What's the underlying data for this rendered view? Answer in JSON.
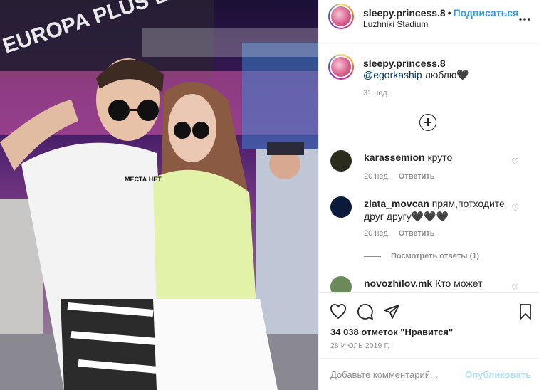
{
  "photo": {
    "stage_sign": "EUROPA PLUS LIVE",
    "shirt_text": "МЕСТА НЕТ"
  },
  "header": {
    "username": "sleepy.princess.8",
    "dot": "•",
    "follow_label": "Подписаться",
    "location": "Luzhniki Stadium",
    "more_icon": "more-horizontal-icon"
  },
  "caption": {
    "username": "sleepy.princess.8",
    "mention": "@egorkaship",
    "text": " люблю🖤",
    "time": "31 нед."
  },
  "load_more_icon": "plus-circle-icon",
  "comments": [
    {
      "username": "karassemion",
      "text": "круто",
      "time": "20 нед.",
      "reply_label": "Ответить",
      "avatar_color": "#2b2b1e"
    },
    {
      "username": "zlata_movcan",
      "text": "прям,потходите друг другу🖤🖤🖤",
      "time": "20 нед.",
      "reply_label": "Ответить",
      "avatar_color": "#0a1a3a"
    },
    {
      "username": "novozhilov.mk",
      "text": "Кто может",
      "avatar_color": "#6a8a5a"
    }
  ],
  "view_replies": "Посмотреть ответы (1)",
  "actions": {
    "like_icon": "heart-icon",
    "comment_icon": "comment-icon",
    "share_icon": "share-icon",
    "save_icon": "bookmark-icon"
  },
  "likes": "34 038 отметок \"Нравится\"",
  "date": "28 ИЮЛЬ 2019 Г.",
  "add_comment": {
    "placeholder": "Добавьте комментарий...",
    "post_label": "Опубликовать"
  },
  "colors": {
    "accent": "#3897f0",
    "post_disabled": "#b2dffc",
    "muted": "#8e8e8e",
    "mention": "#003569"
  }
}
